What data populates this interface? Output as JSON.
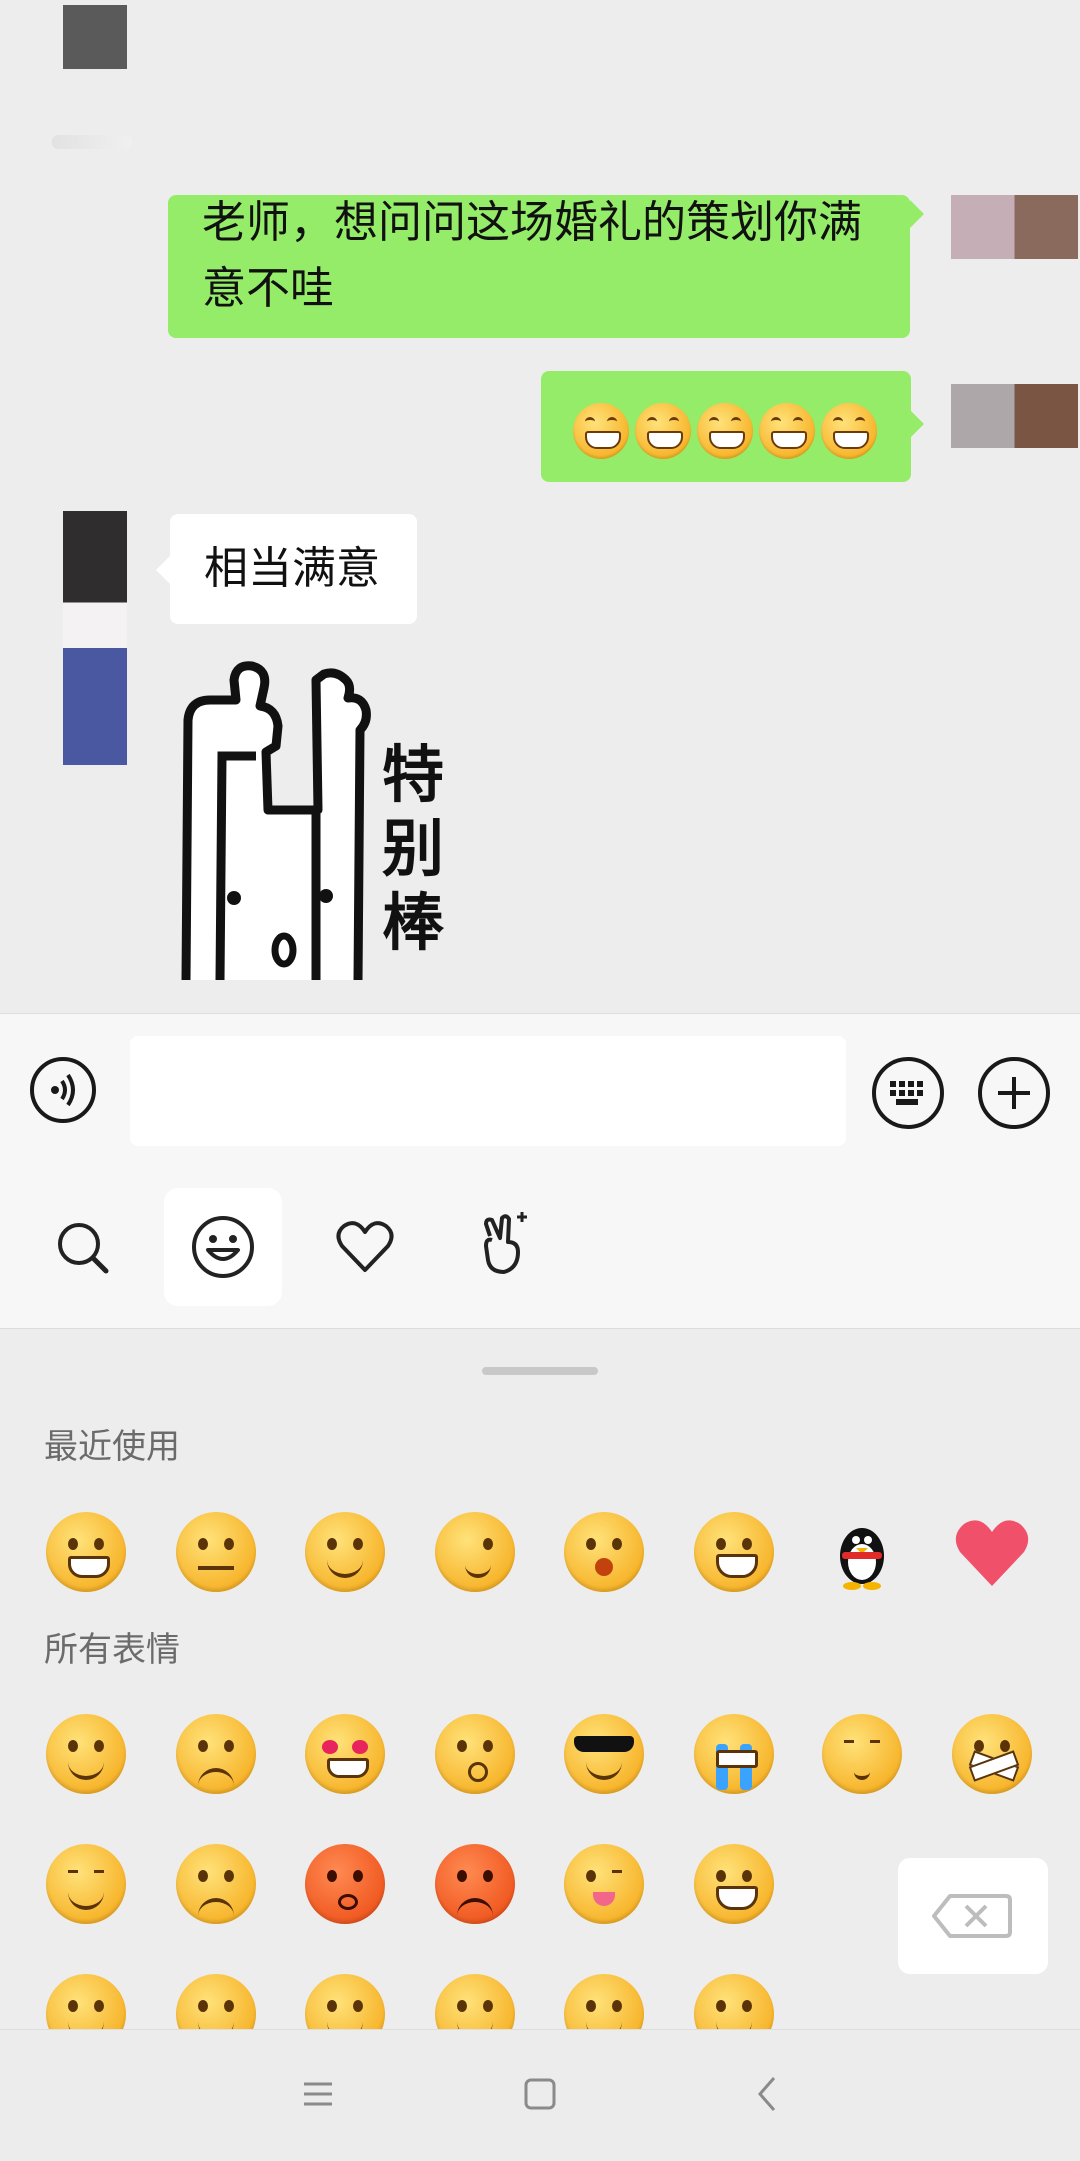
{
  "chat": {
    "messages": [
      {
        "side": "right",
        "type": "text",
        "text": "老师，想问问这场婚礼的策划你满意不哇"
      },
      {
        "side": "right",
        "type": "emoji",
        "emoji_name": "grin-emoji",
        "count": 5
      },
      {
        "side": "left",
        "type": "text",
        "text": "相当满意"
      },
      {
        "side": "left",
        "type": "sticker",
        "sticker_text": "特别棒"
      }
    ]
  },
  "input_bar": {
    "voice_icon": "voice-icon",
    "keyboard_icon": "keyboard-icon",
    "plus_icon": "plus-icon",
    "input_value": ""
  },
  "emoji_tabs": [
    {
      "icon": "search-icon",
      "active": false
    },
    {
      "icon": "smiley-icon",
      "active": true
    },
    {
      "icon": "heart-icon",
      "active": false
    },
    {
      "icon": "gesture-icon",
      "active": false
    }
  ],
  "emoji_panel": {
    "recent_title": "最近使用",
    "all_title": "所有表情",
    "recent": [
      "grin",
      "thinking",
      "smirk",
      "facepalm",
      "wow",
      "big-grin",
      "qq-penguin",
      "heart"
    ],
    "all_rows": [
      [
        "smile",
        "worried",
        "heart-eyes",
        "stare",
        "cool",
        "cry-loud",
        "shy",
        "mouth-tape"
      ],
      [
        "sleepy",
        "angry-tears",
        "sweat-red",
        "angry-red",
        "tongue-wink",
        "grinning"
      ],
      [
        "innocent",
        "laugh-tears",
        "sick",
        "cover-mouth",
        "blush",
        "eyes-up"
      ]
    ],
    "delete_icon": "backspace-icon"
  },
  "nav_bar": {
    "menu_icon": "menu-icon",
    "home_icon": "home-icon",
    "back_icon": "back-icon"
  },
  "colors": {
    "chat_bg": "#ededed",
    "bubble_green": "#95ec69",
    "bubble_white": "#ffffff",
    "panel_bg": "#ededed"
  }
}
